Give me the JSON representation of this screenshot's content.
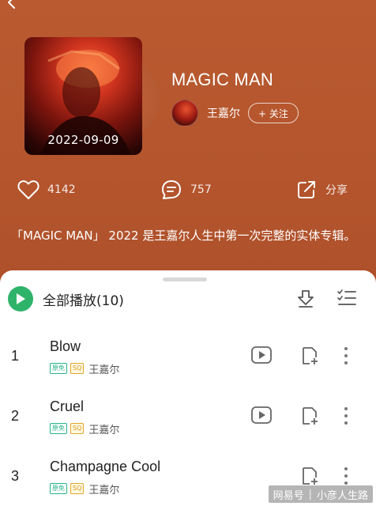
{
  "album": {
    "title": "MAGIC MAN",
    "cover_date": "2022-09-09",
    "description": "「MAGIC MAN」 2022 是王嘉尔人生中第一次完整的实体专辑。"
  },
  "artist": {
    "name": "王嘉尔",
    "follow_label": "+ 关注"
  },
  "stats": {
    "likes": "4142",
    "comments": "757",
    "share_label": "分享"
  },
  "tracklist": {
    "play_all_label": "全部播放(10)",
    "songs": [
      {
        "number": "1",
        "title": "Blow",
        "tag_free": "原免",
        "tag_sq": "SQ",
        "artist": "王嘉尔"
      },
      {
        "number": "2",
        "title": "Cruel",
        "tag_free": "原免",
        "tag_sq": "SQ",
        "artist": "王嘉尔"
      },
      {
        "number": "3",
        "title": "Champagne Cool",
        "tag_free": "原免",
        "tag_sq": "SQ",
        "artist": "王嘉尔"
      }
    ]
  },
  "watermark": {
    "left": "网易号",
    "right": "小彦人生路"
  },
  "colors": {
    "header_bg": "#b8582f",
    "play_green": "#2fb36a",
    "tag_free": "#27b38b",
    "tag_sq": "#e0a82c"
  },
  "icons": {
    "back": "back-arrow-icon",
    "like": "heart-icon",
    "comment": "comment-icon",
    "share": "share-icon",
    "play": "play-icon",
    "download": "download-icon",
    "multi_select": "multi-select-icon",
    "video": "video-icon",
    "add_to_playlist": "add-to-playlist-icon",
    "more": "more-vertical-icon"
  }
}
